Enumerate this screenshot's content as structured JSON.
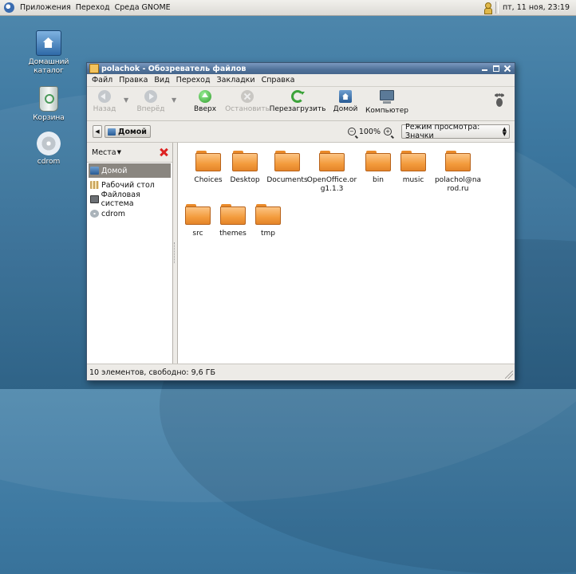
{
  "panel": {
    "menus": [
      "Приложения",
      "Переход",
      "Среда GNOME"
    ],
    "clock": "пт, 11 ноя, 23:19"
  },
  "desktop": {
    "icons": [
      {
        "label": "Домашний каталог",
        "icon": "home-folder-icon"
      },
      {
        "label": "Корзина",
        "icon": "trash-icon"
      },
      {
        "label": "cdrom",
        "icon": "cdrom-icon"
      }
    ]
  },
  "window": {
    "title": "polachok - Обозреватель файлов",
    "menu": [
      "Файл",
      "Правка",
      "Вид",
      "Переход",
      "Закладки",
      "Справка"
    ],
    "toolbar": {
      "back": "Назад",
      "forward": "Вперёд",
      "up": "Вверх",
      "stop": "Остановить",
      "reload": "Перезагрузить",
      "home": "Домой",
      "computer": "Компьютер"
    },
    "location": {
      "path_button": "Домой",
      "zoom": "100%",
      "view_mode": "Режим просмотра: Значки"
    },
    "sidebar": {
      "title": "Места",
      "items": [
        {
          "label": "Домой",
          "icon": "home-icon",
          "selected": true
        },
        {
          "label": "Рабочий стол",
          "icon": "desktop-icon",
          "selected": false
        },
        {
          "label": "Файловая система",
          "icon": "filesystem-icon",
          "selected": false
        },
        {
          "label": "cdrom",
          "icon": "cdrom-icon",
          "selected": false
        }
      ]
    },
    "files": [
      {
        "name": "Choices",
        "label1": "Choices",
        "label2": ""
      },
      {
        "name": "Desktop",
        "label1": "Desktop",
        "label2": ""
      },
      {
        "name": "Documents",
        "label1": "Documents",
        "label2": ""
      },
      {
        "name": "OpenOffice.org1.1.3",
        "label1": "OpenOffice.or",
        "label2": "g1.1.3"
      },
      {
        "name": "bin",
        "label1": "bin",
        "label2": ""
      },
      {
        "name": "music",
        "label1": "music",
        "label2": ""
      },
      {
        "name": "polachol@narod.ru",
        "label1": "polachol@na",
        "label2": "rod.ru"
      },
      {
        "name": "src",
        "label1": "src",
        "label2": ""
      },
      {
        "name": "themes",
        "label1": "themes",
        "label2": ""
      },
      {
        "name": "tmp",
        "label1": "tmp",
        "label2": ""
      }
    ],
    "status": "10 элементов, свободно: 9,6 ГБ"
  },
  "colors": {
    "desktop": "#3f7aa2",
    "titlebar": "#4f7199",
    "folder": "#f39b3c",
    "selection": "#8a8680"
  }
}
